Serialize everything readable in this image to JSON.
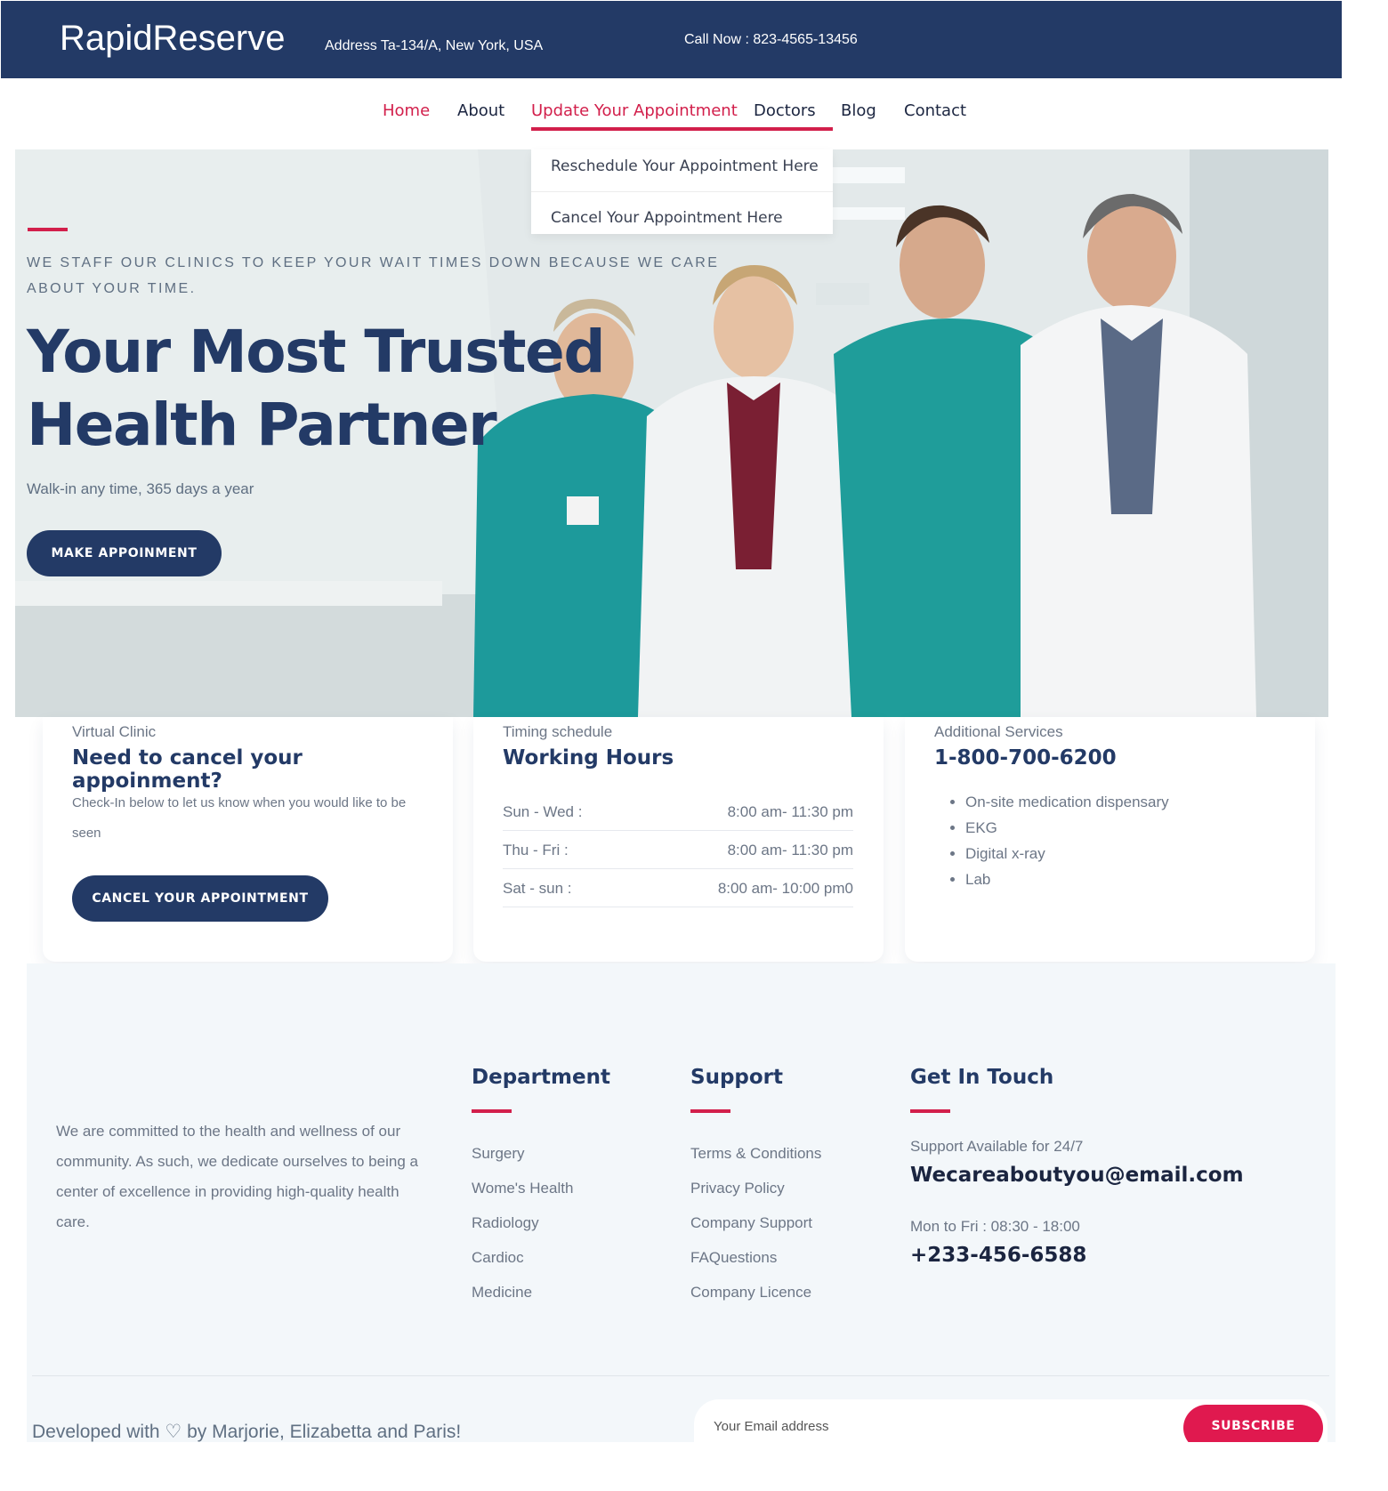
{
  "topbar": {
    "brand": "RapidReserve",
    "address": "Address Ta-134/A, New York, USA",
    "call": "Call Now : 823-4565-13456"
  },
  "nav": {
    "items": [
      {
        "label": "Home",
        "active": true
      },
      {
        "label": "About"
      },
      {
        "label": "Update Your Appointment",
        "active": true
      },
      {
        "label": "Doctors"
      },
      {
        "label": "Blog"
      },
      {
        "label": "Contact"
      }
    ],
    "dropdown": [
      "Reschedule Your Appointment Here",
      "Cancel Your Appointment Here"
    ]
  },
  "hero": {
    "eyebrow": "WE STAFF OUR CLINICS TO KEEP YOUR WAIT TIMES DOWN BECAUSE WE CARE ABOUT YOUR TIME.",
    "title": "Your Most Trusted Health Partner",
    "subtitle": "Walk-in any time, 365 days a year",
    "button": "MAKE APPOINMENT"
  },
  "cards": {
    "cancel": {
      "eyebrow": "Virtual Clinic",
      "title": "Need to cancel your appoinment?",
      "desc": "Check-In below to let us know when you would like to be seen",
      "button": "CANCEL YOUR APPOINTMENT"
    },
    "hours": {
      "eyebrow": "Timing schedule",
      "title": "Working Hours",
      "rows": [
        {
          "day": "Sun - Wed :",
          "time": "8:00 am- 11:30 pm"
        },
        {
          "day": "Thu - Fri :",
          "time": "8:00 am- 11:30 pm"
        },
        {
          "day": "Sat - sun :",
          "time": "8:00 am- 10:00 pm0"
        }
      ]
    },
    "services": {
      "eyebrow": "Additional Services",
      "phone": "1-800-700-6200",
      "items": [
        "On-site medication dispensary",
        "EKG",
        "Digital x-ray",
        "Lab"
      ]
    }
  },
  "footer": {
    "about": "We are committed to the health and wellness of our community. As such, we dedicate ourselves to being a center of excellence in providing high-quality health care.",
    "department": {
      "title": "Department",
      "links": [
        "Surgery",
        "Wome's Health",
        "Radiology",
        "Cardioc",
        "Medicine"
      ]
    },
    "support": {
      "title": "Support",
      "links": [
        "Terms & Conditions",
        "Privacy Policy",
        "Company Support",
        "FAQuestions",
        "Company Licence"
      ]
    },
    "contact": {
      "title": "Get In Touch",
      "support_line": "Support Available for 24/7",
      "email": "Wecareaboutyou@email.com",
      "hours": "Mon to Fri : 08:30 - 18:00",
      "phone": "+233-456-6588"
    },
    "credit": "Developed with ♡ by Marjorie, Elizabetta and Paris!",
    "newsletter": {
      "placeholder": "Your Email address",
      "button": "SUBSCRIBE"
    }
  },
  "colors": {
    "navy": "#233a66",
    "accent": "#d21f4b",
    "subscribe": "#e0194f",
    "footer_bg": "#f3f7fa"
  }
}
